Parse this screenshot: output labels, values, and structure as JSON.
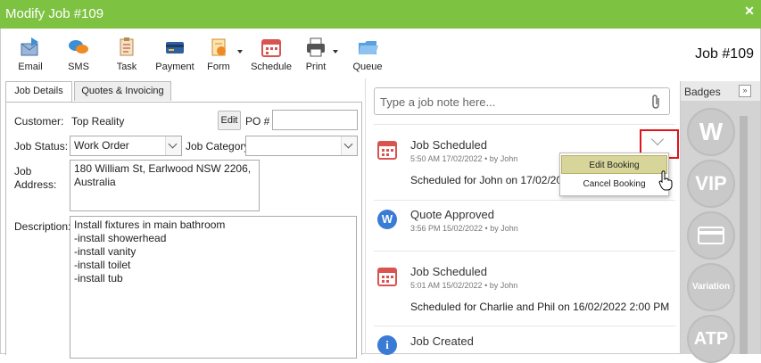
{
  "window": {
    "title": "Modify Job #109",
    "close_symbol": "✕"
  },
  "toolbar": {
    "buttons": [
      {
        "label": "Email",
        "icon": "email-icon"
      },
      {
        "label": "SMS",
        "icon": "sms-icon"
      },
      {
        "label": "Task",
        "icon": "task-icon"
      },
      {
        "label": "Payment",
        "icon": "payment-icon"
      },
      {
        "label": "Form",
        "icon": "form-icon"
      },
      {
        "label": "Schedule",
        "icon": "schedule-icon"
      },
      {
        "label": "Print",
        "icon": "print-icon"
      },
      {
        "label": "Queue",
        "icon": "queue-icon"
      }
    ],
    "job_number": "Job #109"
  },
  "tabs": [
    {
      "label": "Job Details"
    },
    {
      "label": "Quotes & Invoicing"
    }
  ],
  "job_details": {
    "customer_label": "Customer:",
    "customer_value": "Top Reality",
    "edit_label": "Edit",
    "po_label": "PO #",
    "po_value": "",
    "status_label": "Job Status:",
    "status_value": "Work Order",
    "category_label": "Job Category",
    "category_value": "",
    "address_label": "Job Address:",
    "address_value": "180 William St, Earlwood NSW 2206, Australia",
    "description_label": "Description:",
    "description_value": "Install fixtures in main bathroom\n-install showerhead\n-install vanity\n-install toilet\n-install tub"
  },
  "notes": {
    "placeholder": "Type a job note here..."
  },
  "timeline": [
    {
      "title": "Job Scheduled",
      "meta": "5:50 AM 17/02/2022 •  by John",
      "body": "Scheduled for John on 17/02/2022",
      "icon": "calendar-icon"
    },
    {
      "title": "Quote Approved",
      "meta": "3:56 PM 15/02/2022 •  by John",
      "body": "",
      "icon": "w-avatar-icon",
      "avatar_letter": "W"
    },
    {
      "title": "Job Scheduled",
      "meta": "5:01 AM 15/02/2022 •  by John",
      "body": "Scheduled for Charlie and Phil on 16/02/2022 2:00 PM",
      "icon": "calendar-icon"
    },
    {
      "title": "Job Created",
      "meta": "",
      "body": "",
      "icon": "info-icon"
    }
  ],
  "menu": {
    "items": [
      "Edit Booking",
      "Cancel Booking"
    ]
  },
  "badges": {
    "header": "Badges",
    "collapse_symbol": "»",
    "items": [
      {
        "text": "W"
      },
      {
        "text": "VIP"
      },
      {
        "text": ""
      },
      {
        "text": "Variation"
      },
      {
        "text": "ATP"
      }
    ]
  },
  "colors": {
    "titlebar": "#7ec242",
    "highlight": "#e0141a",
    "menu_hover": "#d8d59a",
    "calendar": "#d9534f",
    "avatar": "#3a7bd5"
  }
}
